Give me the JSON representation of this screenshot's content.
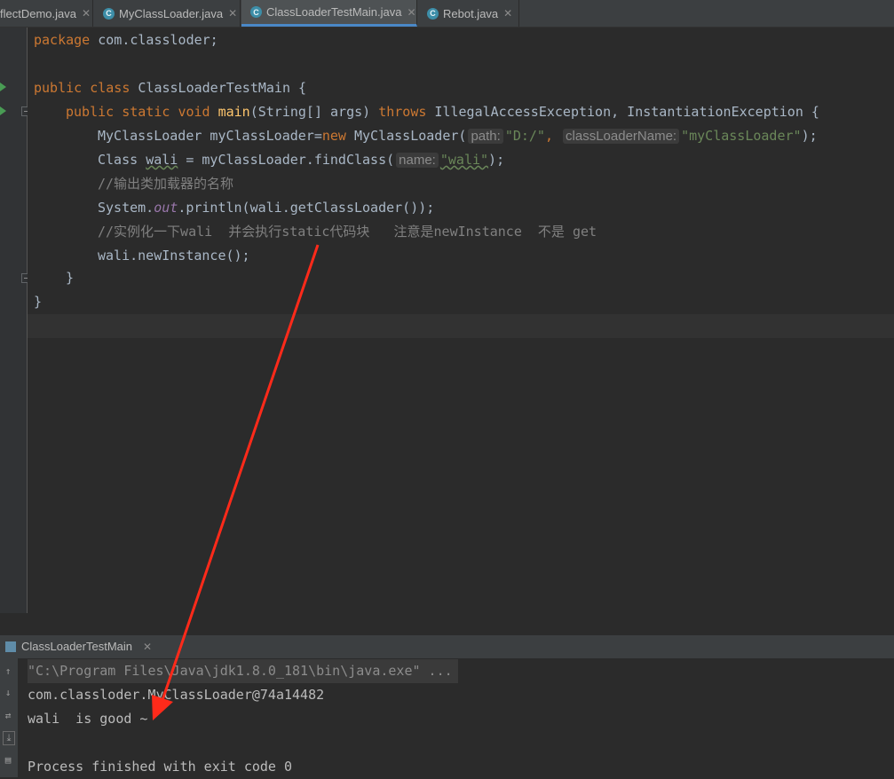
{
  "tabs": [
    {
      "label": "flectDemo.java"
    },
    {
      "label": "MyClassLoader.java"
    },
    {
      "label": "ClassLoaderTestMain.java",
      "active": true
    },
    {
      "label": "Rebot.java"
    }
  ],
  "code": {
    "pkg_kw": "package",
    "pkg_name": " com.classloder;",
    "l3_kw1": "public",
    "l3_kw2": "class",
    "l3_rest": " ClassLoaderTestMain {",
    "l4_kw1": "public",
    "l4_kw2": "static",
    "l4_kw3": "void",
    "l4_fn": "main",
    "l4_args": "(String[] args) ",
    "l4_throws": "throws",
    "l4_rest": " IllegalAccessException, InstantiationException {",
    "l5_a": "MyClassLoader myClassLoader=",
    "l5_new": "new",
    "l5_b": " MyClassLoader(",
    "l5_hint1": "path:",
    "l5_str1": "\"D:/\"",
    "l5_comma": ",",
    "l5_hint2": "classLoaderName:",
    "l5_str2": "\"myClassLoader\"",
    "l5_end": ");",
    "l6_a": "Class ",
    "l6_var": "wali",
    "l6_b": " = myClassLoader.findClass(",
    "l6_hint": "name:",
    "l6_str": "\"wali\"",
    "l6_end": ");",
    "l7_comment": "//输出类加载器的名称",
    "l8_a": "System.",
    "l8_out": "out",
    "l8_b": ".println(wali.getClassLoader());",
    "l9_comment": "//实例化一下wali  并会执行static代码块   注意是newInstance  不是 get",
    "l10": "wali.newInstance();",
    "l11": "}",
    "l12": "}"
  },
  "run": {
    "tab_label": "ClassLoaderTestMain",
    "cmd": "\"C:\\Program Files\\Java\\jdk1.8.0_181\\bin\\java.exe\" ...",
    "out1": "com.classloder.MyClassLoader@74a14482",
    "out2": "wali  is good ~",
    "out3": "",
    "out4": "Process finished with exit code 0"
  },
  "colors": {
    "keyword": "#cc7832",
    "string": "#6a8759",
    "comment": "#808080",
    "arrow": "#ff2a1a"
  }
}
